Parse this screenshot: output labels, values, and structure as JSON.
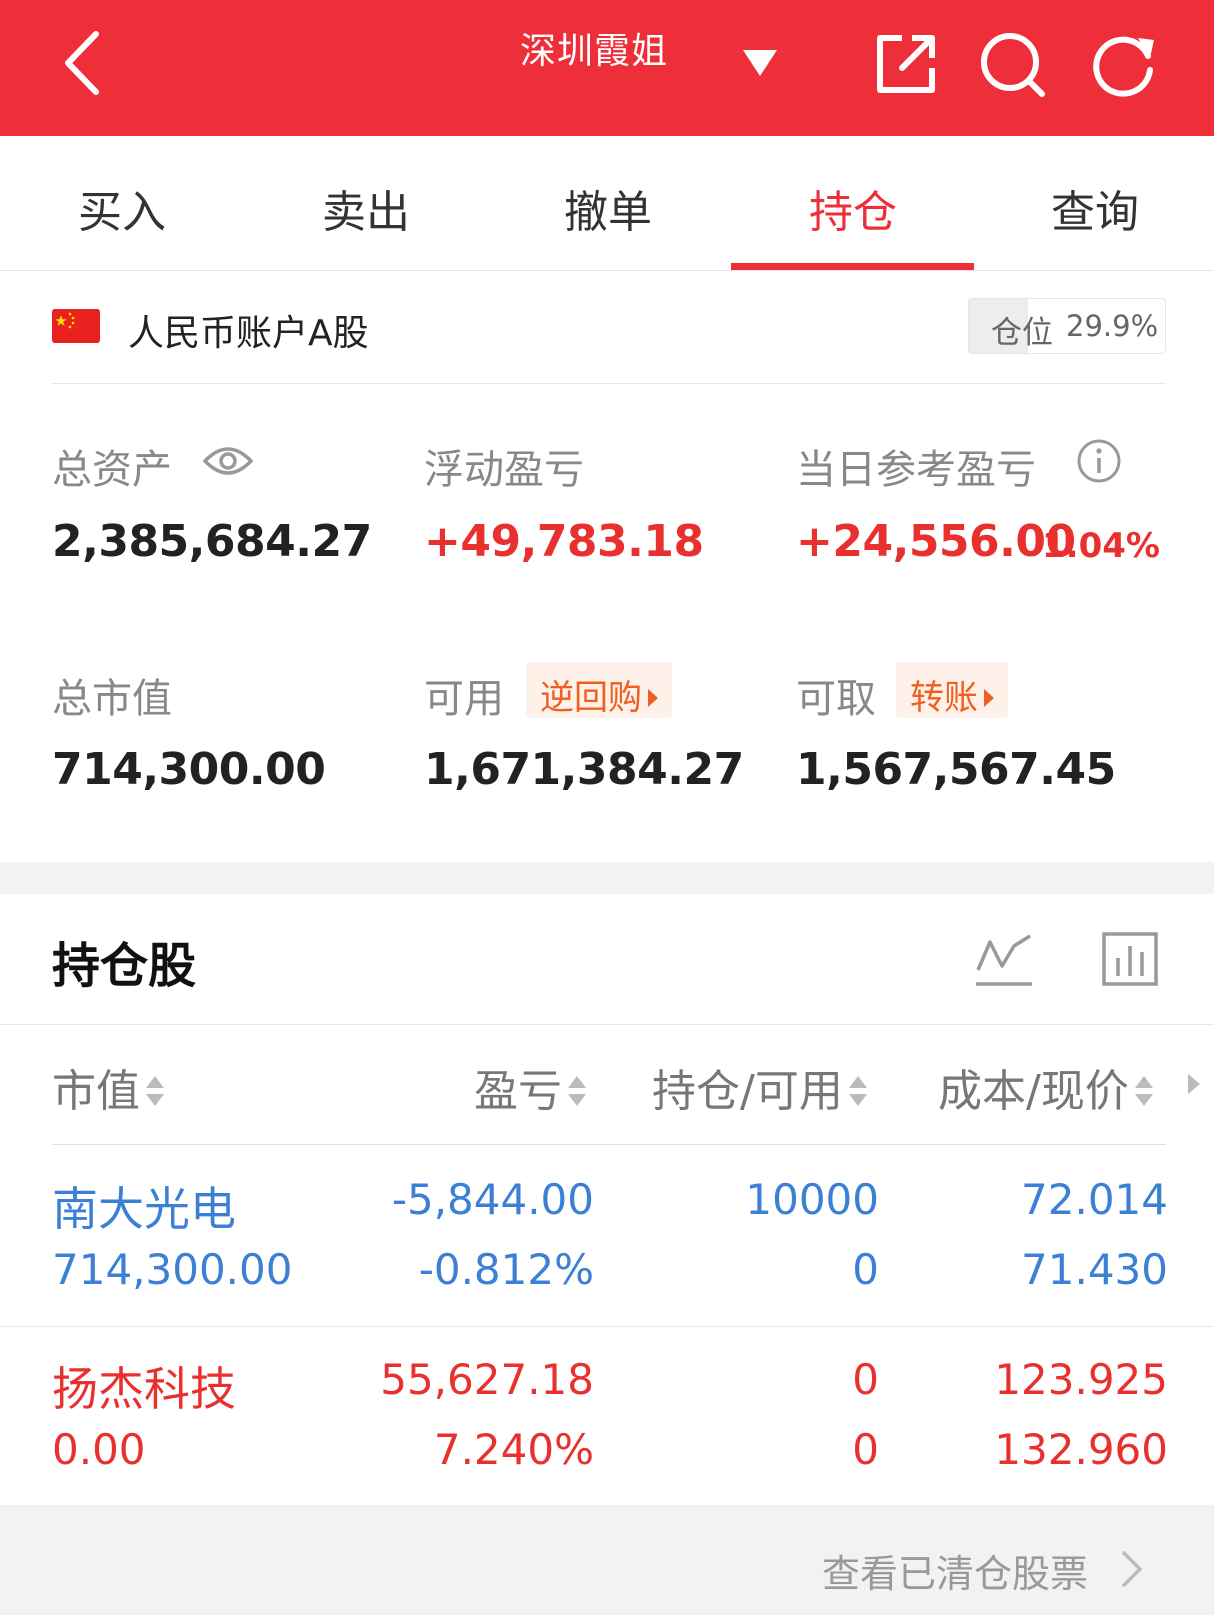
{
  "header": {
    "title": "深圳霞姐"
  },
  "tabs": [
    {
      "label": "买入"
    },
    {
      "label": "卖出"
    },
    {
      "label": "撤单"
    },
    {
      "label": "持仓",
      "active": true
    },
    {
      "label": "查询"
    }
  ],
  "account": {
    "name": "人民币账户A股",
    "position_label": "仓位",
    "position_value": "29.9%",
    "position_fraction": 0.299
  },
  "stats": {
    "total_assets_label": "总资产",
    "total_assets": "2,385,684.27",
    "floating_pl_label": "浮动盈亏",
    "floating_pl": "+49,783.18",
    "daily_pl_label": "当日参考盈亏",
    "daily_pl": "+24,556.00",
    "daily_pl_pct": "1.04%",
    "market_value_label": "总市值",
    "market_value": "714,300.00",
    "available_label": "可用",
    "reverse_repo_label": "逆回购",
    "available": "1,671,384.27",
    "withdrawable_label": "可取",
    "transfer_label": "转账",
    "withdrawable": "1,567,567.45"
  },
  "holdings": {
    "title": "持仓股",
    "columns": [
      "市值",
      "盈亏",
      "持仓/可用",
      "成本/现价"
    ],
    "rows": [
      {
        "name": "南大光电",
        "market_value": "714,300.00",
        "pl": "-5,844.00",
        "pl_pct": "-0.812%",
        "holding": "10000",
        "available": "0",
        "cost": "72.014",
        "price": "71.430",
        "color": "#3b80d4"
      },
      {
        "name": "扬杰科技",
        "market_value": "0.00",
        "pl": "55,627.18",
        "pl_pct": "7.240%",
        "holding": "0",
        "available": "0",
        "cost": "123.925",
        "price": "132.960",
        "color": "#e8312e"
      }
    ]
  },
  "footer": {
    "link": "查看已清仓股票"
  },
  "colors": {
    "brand_red": "#ee2f3a",
    "loss_blue": "#3b80d4",
    "gain_red": "#e8312e",
    "orange": "#f05f1f"
  }
}
